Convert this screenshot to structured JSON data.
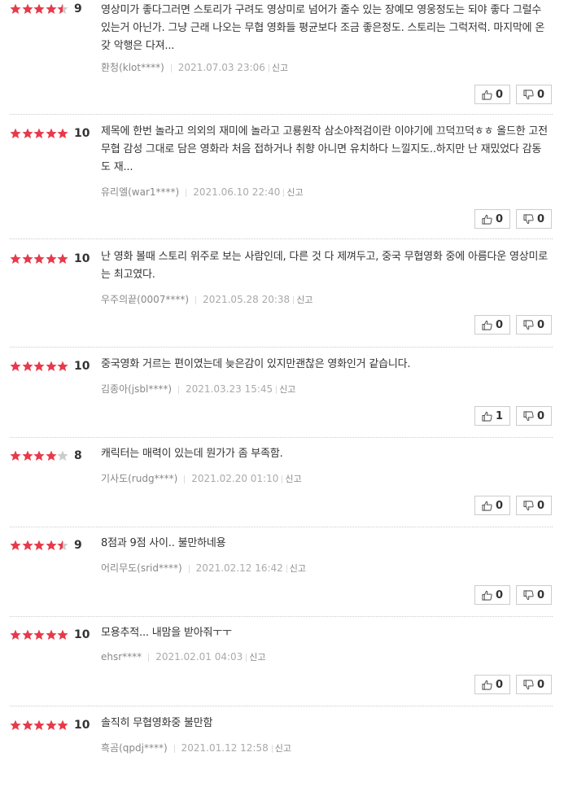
{
  "colors": {
    "star_on": "#e8394a",
    "star_off": "#cccccc"
  },
  "reviews": [
    {
      "stars": 4.5,
      "score": "9",
      "text": "영상미가 좋다그러면 스토리가 구려도 영상미로 넘어가 줄수 있는 장예모 영웅정도는 되야 좋다 그럴수 있는거 아닌가. 그냥 근래 나오는 무협 영화들 평균보다 조금 좋은정도. 스토리는 그럭저럭. 마지막에 온갖 악행은 다져...",
      "user": "환청(klot****)",
      "date": "2021.07.03 23:06",
      "report": "신고",
      "like": "0",
      "dislike": "0"
    },
    {
      "stars": 5,
      "score": "10",
      "text": "제목에 한번 놀라고 의외의 재미에 놀라고 고룡원작 삼소야적검이란 이야기에 끄덕끄덕ㅎㅎ 올드한 고전무협 감성 그대로 담은 영화라 처음 접하거나 취향 아니면 유치하다 느낄지도..하지만 난 재밌었다 감동도 재...",
      "user": "유리엘(war1****)",
      "date": "2021.06.10 22:40",
      "report": "신고",
      "like": "0",
      "dislike": "0"
    },
    {
      "stars": 5,
      "score": "10",
      "text": "난 영화 볼때 스토리 위주로 보는 사람인데, 다른 것 다 제껴두고, 중국 무협영화 중에 아름다운 영상미로는 최고였다.",
      "user": "우주의끝(0007****)",
      "date": "2021.05.28 20:38",
      "report": "신고",
      "like": "0",
      "dislike": "0"
    },
    {
      "stars": 5,
      "score": "10",
      "text": "중국영화 거르는 편이였는데 늦은감이 있지만괜찮은 영화인거 같습니다.",
      "user": "김종아(jsbl****)",
      "date": "2021.03.23 15:45",
      "report": "신고",
      "like": "1",
      "dislike": "0"
    },
    {
      "stars": 4,
      "score": "8",
      "text": "캐릭터는 매력이 있는데 뭔가가 좀 부족함.",
      "user": "기사도(rudg****)",
      "date": "2021.02.20 01:10",
      "report": "신고",
      "like": "0",
      "dislike": "0"
    },
    {
      "stars": 4.5,
      "score": "9",
      "text": "8점과 9점 사이.. 불만하네용",
      "user": "어리무도(srid****)",
      "date": "2021.02.12 16:42",
      "report": "신고",
      "like": "0",
      "dislike": "0"
    },
    {
      "stars": 5,
      "score": "10",
      "text": "모용추적... 내맘을 받아줘ㅜㅜ",
      "user": "ehsr****",
      "date": "2021.02.01 04:03",
      "report": "신고",
      "like": "0",
      "dislike": "0"
    },
    {
      "stars": 5,
      "score": "10",
      "text": "솔직히 무협영화중 불만함",
      "user": "흑곰(qpdj****)",
      "date": "2021.01.12 12:58",
      "report": "신고",
      "like": "",
      "dislike": ""
    }
  ]
}
